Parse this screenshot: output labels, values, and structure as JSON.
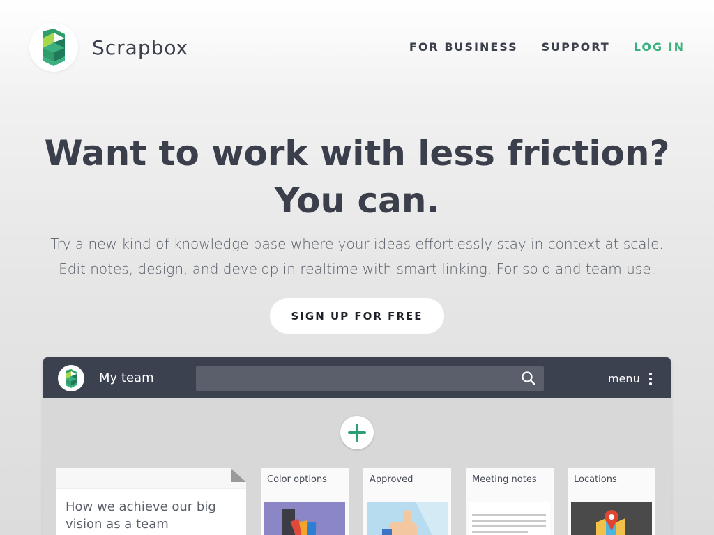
{
  "brand": {
    "name": "Scrapbox"
  },
  "nav": {
    "items": [
      {
        "label": "FOR BUSINESS"
      },
      {
        "label": "SUPPORT"
      },
      {
        "label": "LOG IN"
      }
    ]
  },
  "hero": {
    "title": "Want to work with less friction? You can.",
    "subtitle": "Try a new kind of knowledge base where your ideas effortlessly stay in context at scale. Edit notes, design, and develop in realtime with smart linking. For solo and team use.",
    "cta": "SIGN UP FOR FREE"
  },
  "app": {
    "team_name": "My team",
    "search_placeholder": "",
    "menu_label": "menu",
    "cards": [
      {
        "title": "How we achieve our big vision as a team"
      },
      {
        "title": "Color options",
        "icon": "color-swatch-icon"
      },
      {
        "title": "Approved",
        "icon": "thumbs-up-icon"
      },
      {
        "title": "Meeting notes",
        "icon": "text-lines-icon"
      },
      {
        "title": "Locations",
        "icon": "map-pin-icon"
      }
    ]
  },
  "colors": {
    "accent": "#3bb07f",
    "text": "#3a3f4b",
    "app_bar": "#3c4150"
  }
}
